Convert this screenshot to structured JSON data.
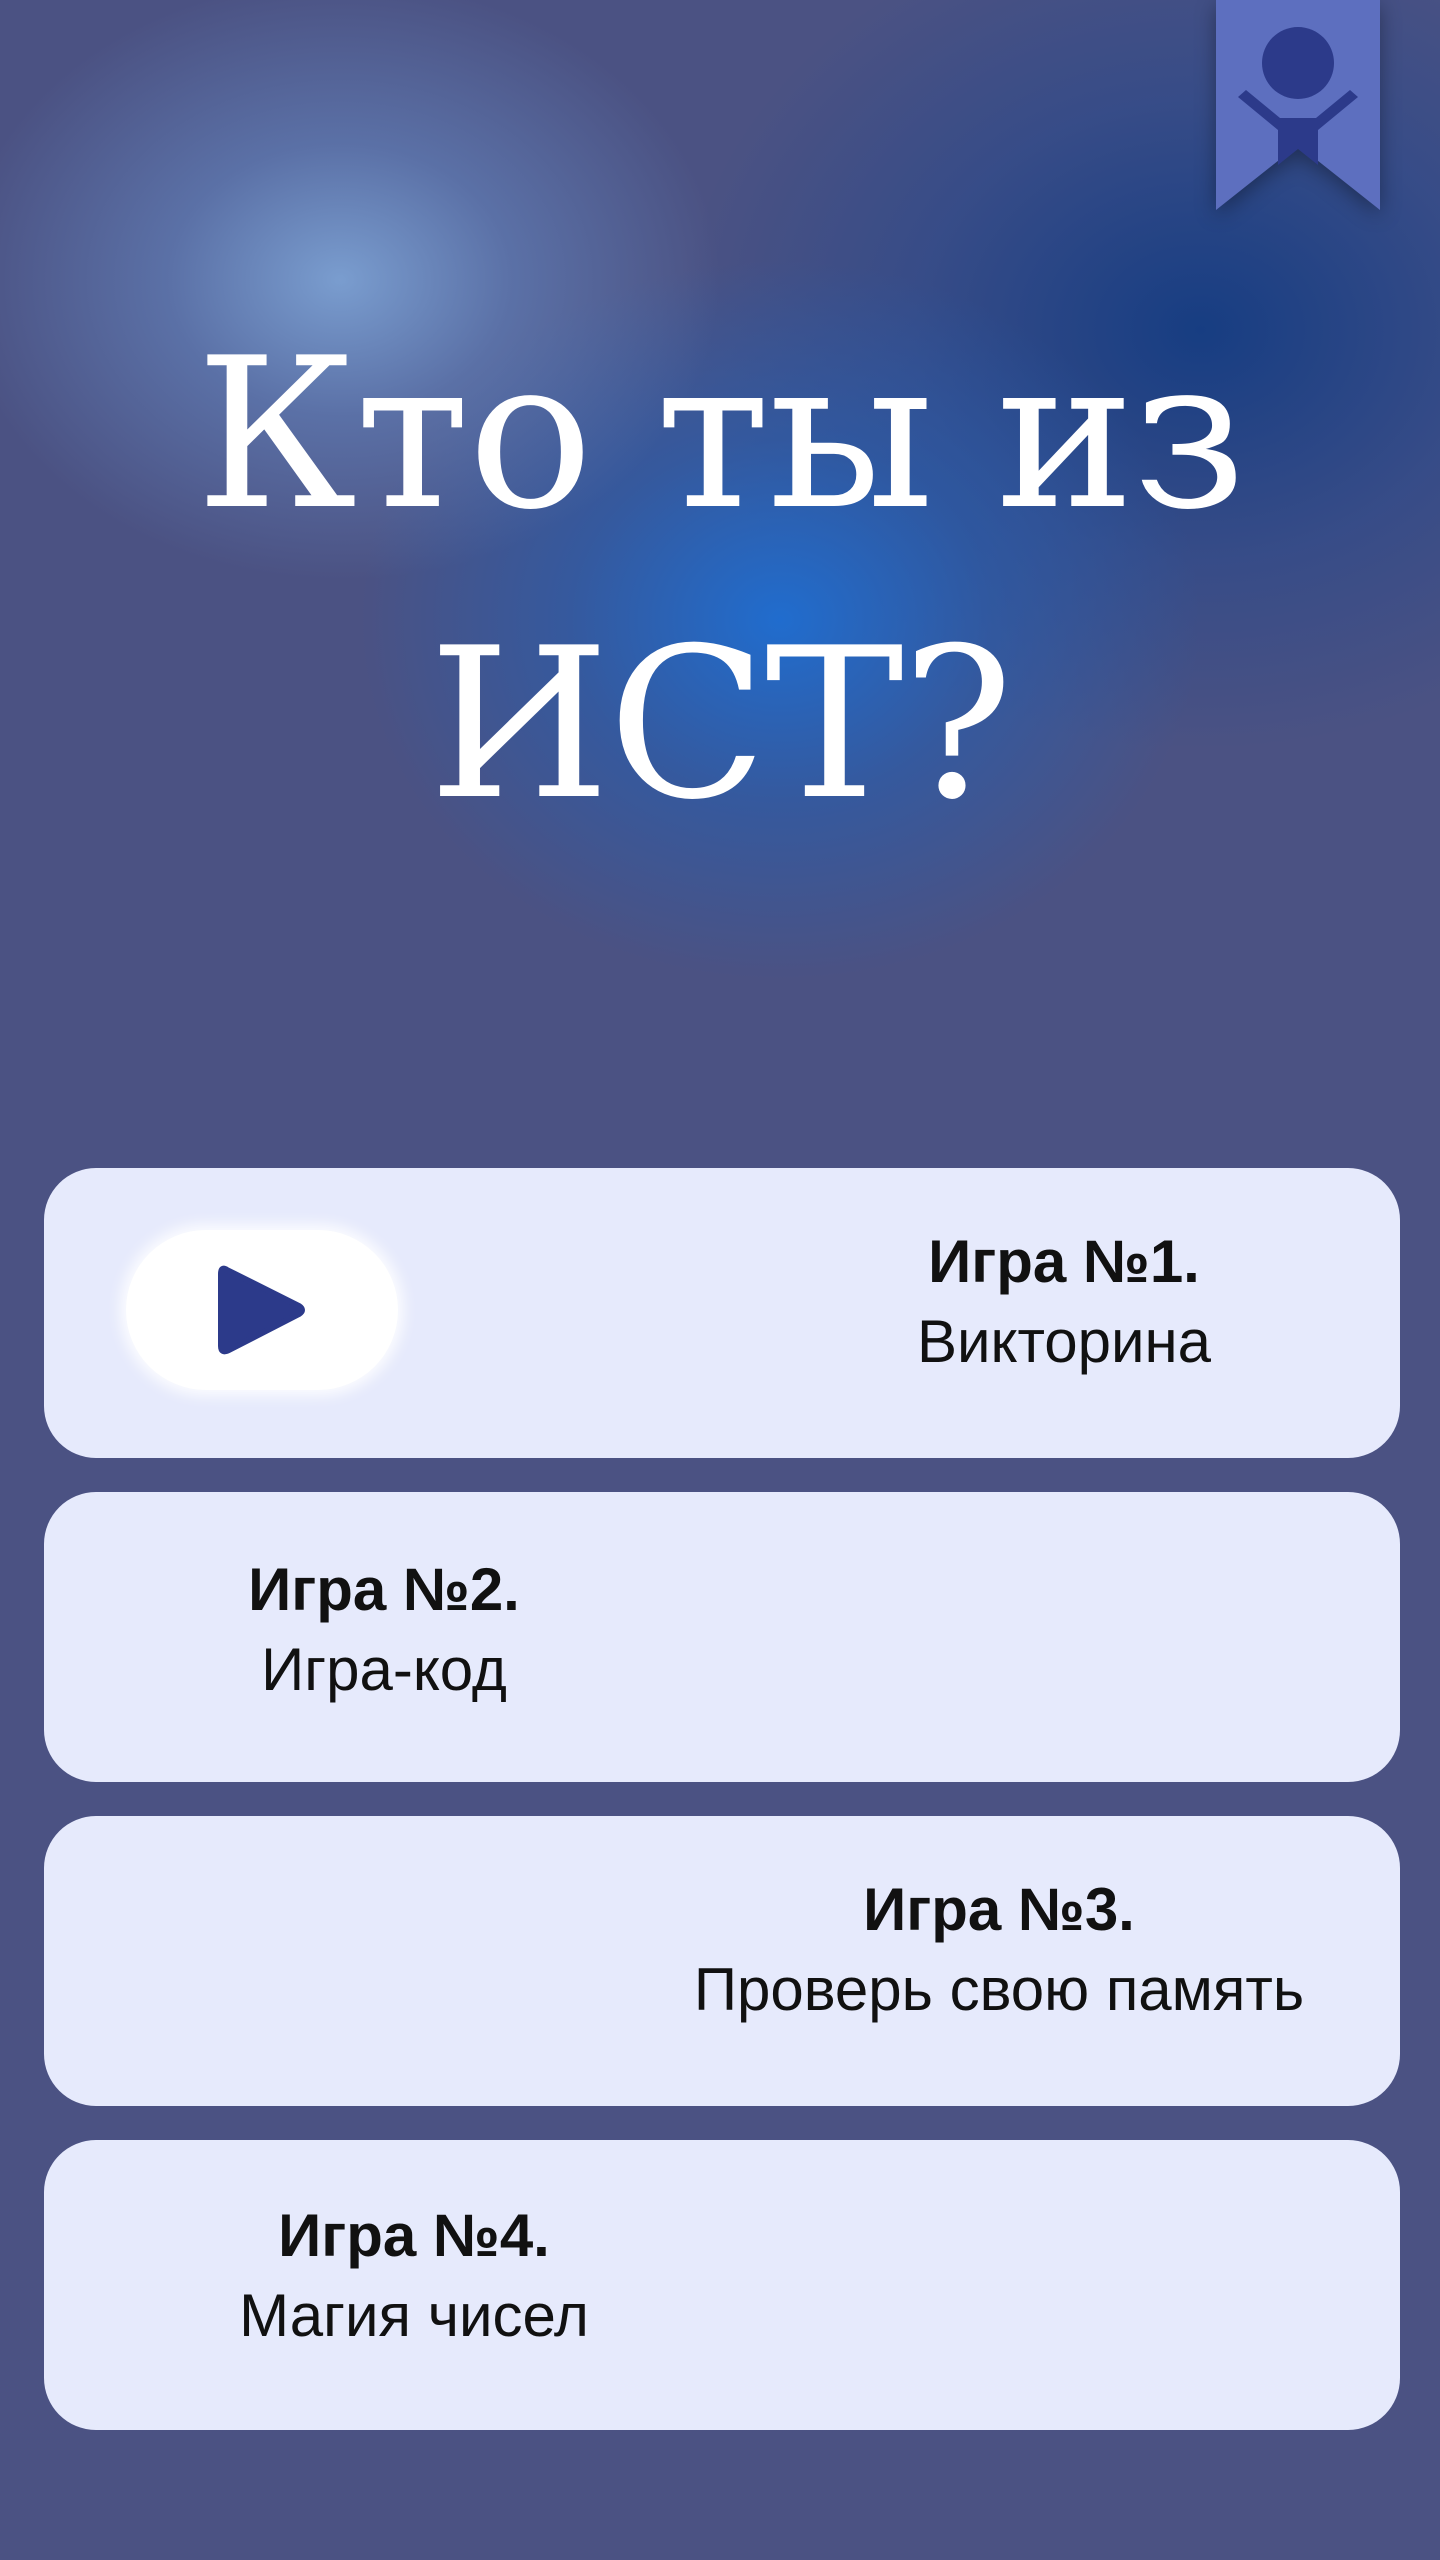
{
  "app": {
    "title": "Кто ты из ИСТ?",
    "bg_color": "#4b5283",
    "card_color": "#e6eafc",
    "accent_color": "#2c3a8a",
    "bookmark_color": "#5d6fbf"
  },
  "profile": {
    "icon": "person-icon"
  },
  "games": [
    {
      "number": "Игра №1.",
      "name": "Викторина"
    },
    {
      "number": "Игра №2.",
      "name": "Игра-код"
    },
    {
      "number": "Игра №3.",
      "name": "Проверь свою память"
    },
    {
      "number": "Игра №4.",
      "name": "Магия чисел"
    }
  ],
  "play": {
    "icon": "play-icon"
  }
}
